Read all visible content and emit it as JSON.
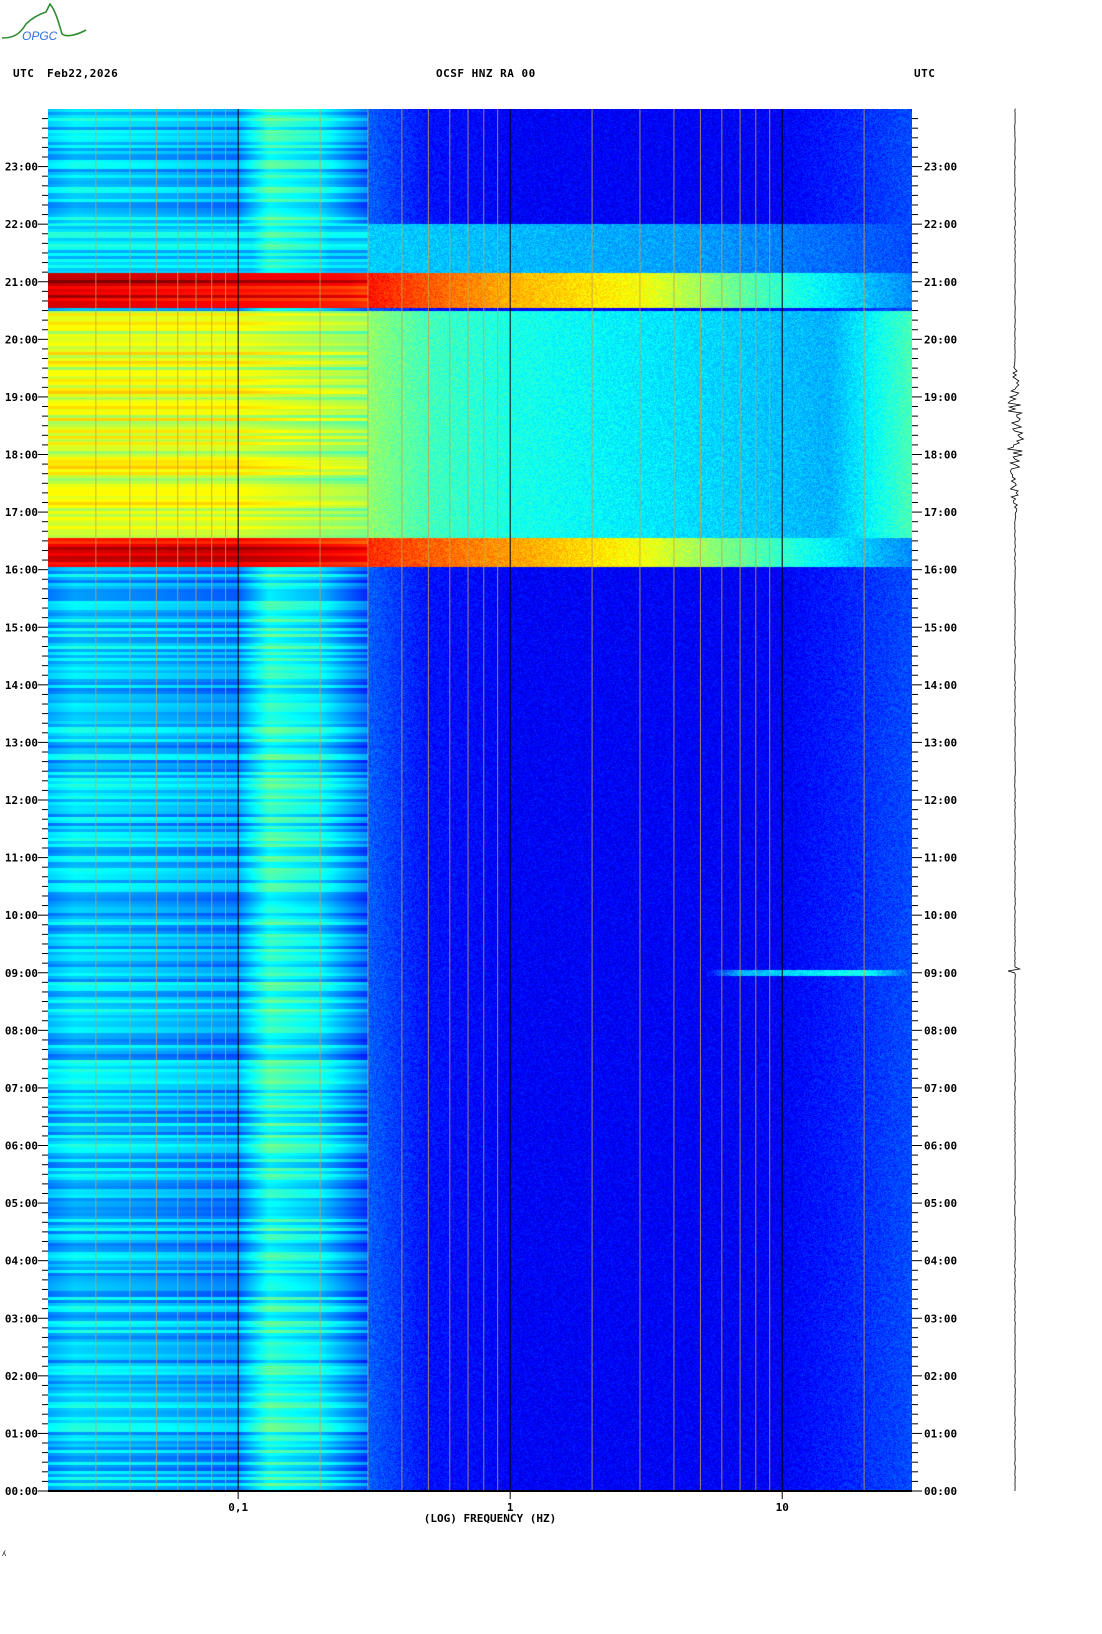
{
  "logo": {
    "text": "OPGC"
  },
  "header": {
    "tz_left": "UTC",
    "date": "Feb22,2026",
    "title": "OCSF HNZ RA 00",
    "tz_right": "UTC"
  },
  "footer_mark": "ʎ",
  "chart_data": {
    "type": "heatmap",
    "title": "OCSF HNZ RA 00",
    "xlabel": "(LOG) FREQUENCY (HZ)",
    "ylabel": "UTC",
    "x_scale": "log",
    "xlim": [
      0.02,
      30
    ],
    "ylim": [
      0,
      24
    ],
    "colormap": "jet",
    "x_ticks": [
      {
        "value": 0.1,
        "label": "0,1"
      },
      {
        "value": 1,
        "label": "1"
      },
      {
        "value": 10,
        "label": "10"
      }
    ],
    "x_gridlines_hz": [
      0.03,
      0.04,
      0.05,
      0.06,
      0.07,
      0.08,
      0.09,
      0.1,
      0.2,
      0.3,
      0.4,
      0.5,
      0.6,
      0.7,
      0.8,
      0.9,
      1,
      2,
      3,
      4,
      5,
      6,
      7,
      8,
      9,
      10,
      20
    ],
    "y_tick_labels": [
      "00:00",
      "01:00",
      "02:00",
      "03:00",
      "04:00",
      "05:00",
      "06:00",
      "07:00",
      "08:00",
      "09:00",
      "10:00",
      "11:00",
      "12:00",
      "13:00",
      "14:00",
      "15:00",
      "16:00",
      "17:00",
      "18:00",
      "19:00",
      "20:00",
      "21:00",
      "22:00",
      "23:00"
    ],
    "y_minor_tick_minutes": 10,
    "background_profile": [
      [
        0.02,
        0.3
      ],
      [
        0.025,
        0.34
      ],
      [
        0.05,
        0.31
      ],
      [
        0.1,
        0.27
      ],
      [
        0.13,
        0.42
      ],
      [
        0.2,
        0.36
      ],
      [
        0.3,
        0.22
      ],
      [
        0.5,
        0.14
      ],
      [
        1,
        0.12
      ],
      [
        10,
        0.12
      ],
      [
        30,
        0.2
      ]
    ],
    "events": [
      {
        "start": 16.05,
        "end": 16.55,
        "profile": [
          [
            0.02,
            0.88
          ],
          [
            0.1,
            0.9
          ],
          [
            0.25,
            0.85
          ],
          [
            1,
            0.72
          ],
          [
            3,
            0.62
          ],
          [
            6,
            0.5
          ],
          [
            30,
            0.26
          ]
        ]
      },
      {
        "start": 16.55,
        "end": 20.5,
        "profile": [
          [
            0.02,
            0.6
          ],
          [
            0.1,
            0.6
          ],
          [
            0.3,
            0.52
          ],
          [
            0.5,
            0.44
          ],
          [
            1,
            0.4
          ],
          [
            5,
            0.34
          ],
          [
            15,
            0.3
          ],
          [
            30,
            0.45
          ]
        ]
      },
      {
        "start": 20.55,
        "end": 21.15,
        "profile": [
          [
            0.02,
            0.95
          ],
          [
            0.25,
            0.88
          ],
          [
            1,
            0.7
          ],
          [
            3,
            0.62
          ],
          [
            8,
            0.45
          ],
          [
            30,
            0.26
          ]
        ]
      },
      {
        "start": 21.15,
        "end": 22.0,
        "profile": [
          [
            0.02,
            0.36
          ],
          [
            0.5,
            0.32
          ],
          [
            5,
            0.28
          ],
          [
            30,
            0.2
          ]
        ]
      },
      {
        "start": 8.95,
        "end": 9.05,
        "profile": [
          [
            0.02,
            0.0
          ],
          [
            5,
            0.1
          ],
          [
            7,
            0.3
          ],
          [
            20,
            0.4
          ],
          [
            30,
            0.2
          ]
        ]
      }
    ],
    "trace_activity": [
      {
        "start": 16.9,
        "end": 19.6
      },
      {
        "start": 9.0,
        "end": 9.1
      }
    ]
  }
}
